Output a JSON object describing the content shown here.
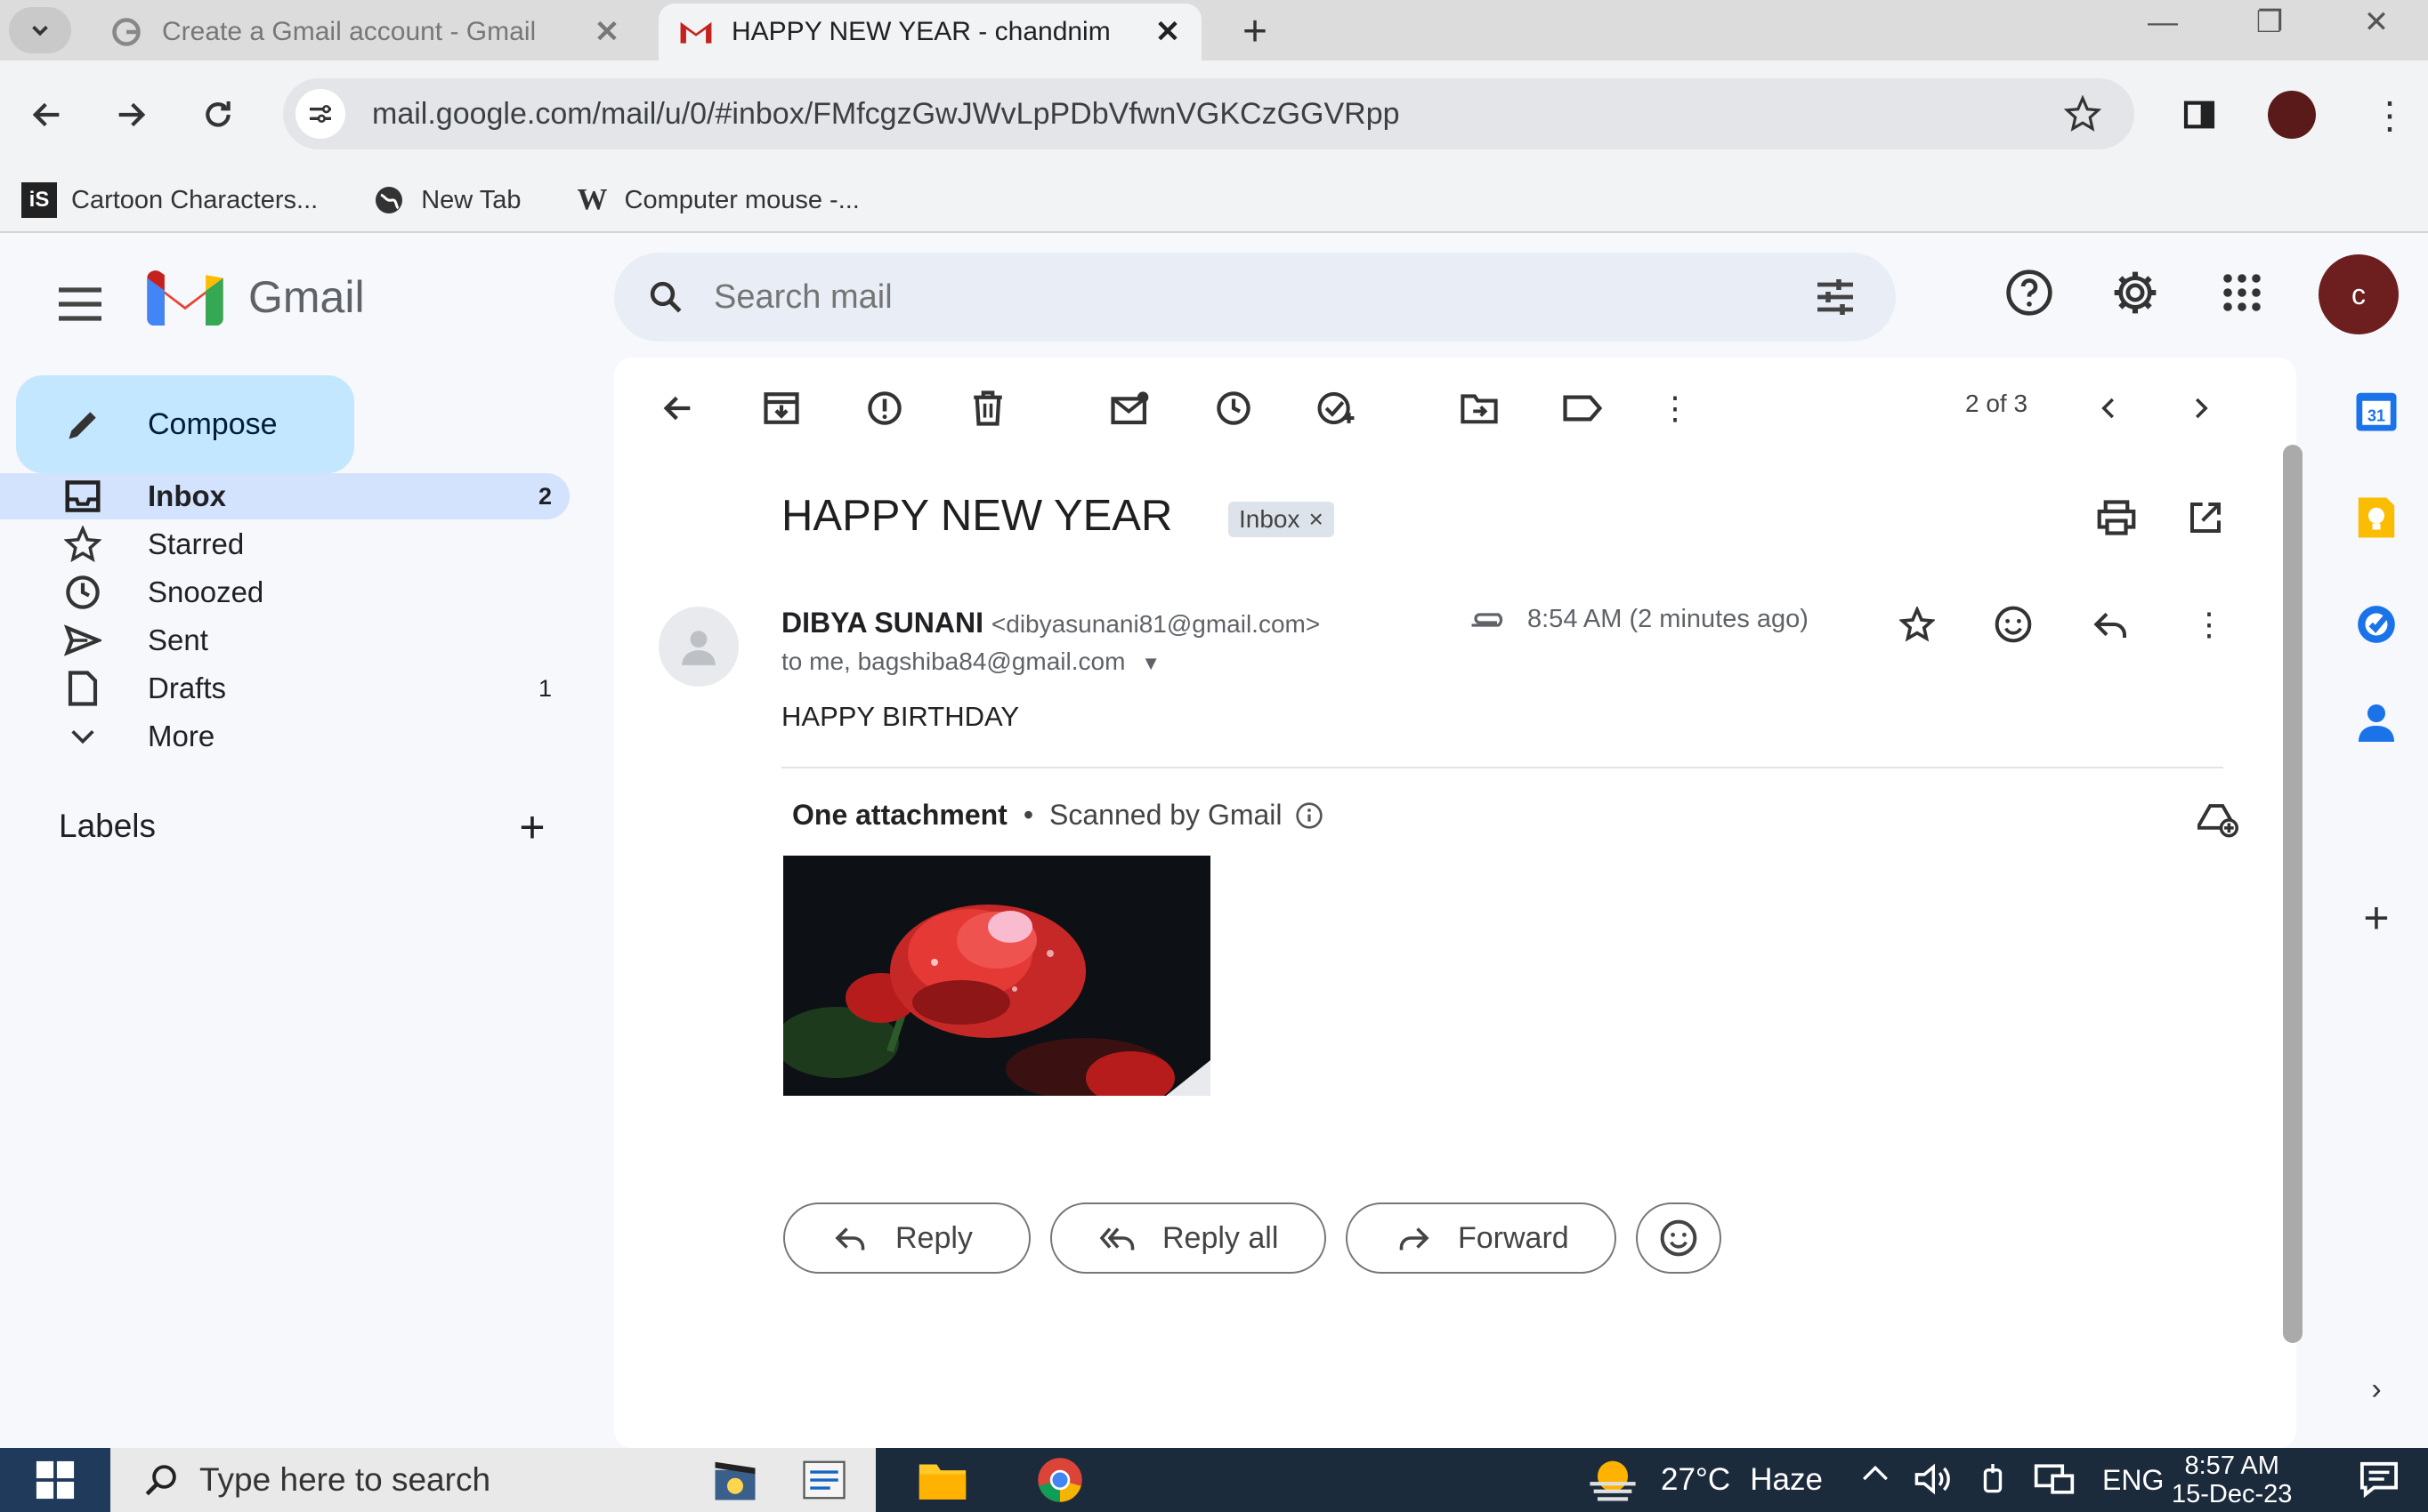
{
  "browser": {
    "tabs": [
      {
        "title": "Create a Gmail account - Gmail",
        "active": false
      },
      {
        "title": "HAPPY NEW YEAR - chandnim",
        "active": true
      }
    ],
    "url": "mail.google.com/mail/u/0/#inbox/FMfcgzGwJWvLpPDbVfwnVGKCzGGVRpp",
    "bookmarks": [
      {
        "label": "Cartoon Characters...",
        "icon": "istock-icon"
      },
      {
        "label": "New Tab",
        "icon": "globe-icon"
      },
      {
        "label": "Computer mouse -...",
        "icon": "wikipedia-icon"
      }
    ]
  },
  "gmail": {
    "brand": "Gmail",
    "search_placeholder": "Search mail",
    "avatar_initial": "c",
    "compose_label": "Compose",
    "nav": [
      {
        "label": "Inbox",
        "count": "2",
        "icon": "inbox-icon"
      },
      {
        "label": "Starred",
        "count": "",
        "icon": "star-icon"
      },
      {
        "label": "Snoozed",
        "count": "",
        "icon": "clock-icon"
      },
      {
        "label": "Sent",
        "count": "",
        "icon": "send-icon"
      },
      {
        "label": "Drafts",
        "count": "1",
        "icon": "draft-icon"
      },
      {
        "label": "More",
        "count": "",
        "icon": "chevron-down-icon"
      }
    ],
    "labels_heading": "Labels",
    "pager": "2 of 3"
  },
  "message": {
    "subject": "HAPPY NEW YEAR",
    "label_chip": "Inbox",
    "sender_name": "DIBYA SUNANI",
    "sender_email": "<dibyasunani81@gmail.com>",
    "recipients": "to me, bagshiba84@gmail.com",
    "time": "8:54 AM (2 minutes ago)",
    "body": "HAPPY BIRTHDAY",
    "attachment_title": "One attachment",
    "attachment_scan": "Scanned by Gmail",
    "reply": "Reply",
    "reply_all": "Reply all",
    "forward": "Forward"
  },
  "taskbar": {
    "search_placeholder": "Type here to search",
    "temperature": "27°C",
    "weather": "Haze",
    "language": "ENG",
    "time": "8:57 AM",
    "date": "15-Dec-23"
  },
  "colors": {
    "accent": "#0b57d0",
    "compose_bg": "#c2e7ff",
    "active_nav": "#d3e3fd",
    "gmail_red": "#ea4335",
    "avatar": "#6d1f1f",
    "taskbar": "#1c2b3c"
  }
}
